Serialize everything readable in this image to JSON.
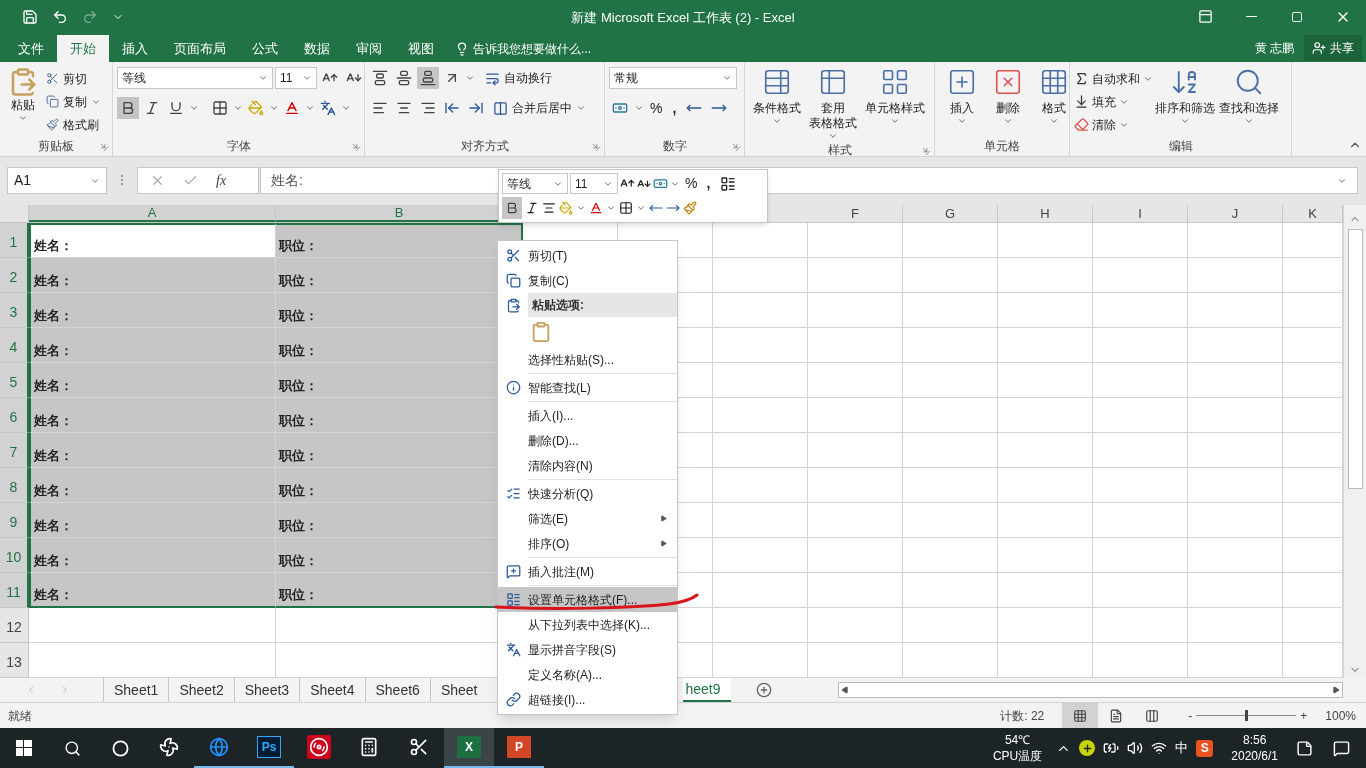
{
  "window": {
    "title": "新建 Microsoft Excel 工作表 (2) - Excel"
  },
  "tabs": [
    {
      "label": "文件",
      "selected": false
    },
    {
      "label": "开始",
      "selected": true
    },
    {
      "label": "插入",
      "selected": false
    },
    {
      "label": "页面布局",
      "selected": false
    },
    {
      "label": "公式",
      "selected": false
    },
    {
      "label": "数据",
      "selected": false
    },
    {
      "label": "审阅",
      "selected": false
    },
    {
      "label": "视图",
      "selected": false
    }
  ],
  "tell_me": {
    "placeholder": "告诉我您想要做什么..."
  },
  "user": {
    "name": "黄 志鹏",
    "share": "共享"
  },
  "ribbon": {
    "clipboard": {
      "label": "剪贴板",
      "paste": "粘贴",
      "items": [
        "剪切",
        "复制",
        "格式刷"
      ]
    },
    "font": {
      "label": "字体",
      "font_name": "等线",
      "font_size": "11",
      "toggles": [
        {
          "on": true
        },
        {
          "on": false
        },
        {
          "on": false
        }
      ]
    },
    "alignment": {
      "label": "对齐方式",
      "align_buttons": [
        {
          "on": false
        },
        {
          "on": false
        },
        {
          "on": true
        },
        {
          "on": false
        },
        {
          "on": false
        },
        {
          "on": false
        }
      ],
      "wrap": "自动换行",
      "merge": "合并后居中"
    },
    "number": {
      "label": "数字",
      "format": "常规",
      "percent": "%",
      "comma": ","
    },
    "styles": {
      "label": "样式",
      "buttons": [
        {
          "lines": [
            "条件格式"
          ]
        },
        {
          "lines": [
            "套用",
            "表格格式"
          ]
        },
        {
          "lines": [
            "单元格样式"
          ]
        }
      ]
    },
    "cells": {
      "label": "单元格",
      "buttons": [
        "插入",
        "删除",
        "格式"
      ]
    },
    "editing": {
      "label": "编辑",
      "small": [
        "自动求和",
        "填充",
        "清除"
      ],
      "large": [
        "排序和筛选",
        "查找和选择"
      ]
    }
  },
  "formula_bar": {
    "name_box": "A1",
    "fx": "fx",
    "value": "姓名:"
  },
  "columns": [
    {
      "label": "A",
      "selected": true
    },
    {
      "label": "B",
      "selected": true
    },
    {
      "label": "F",
      "selected": false
    },
    {
      "label": "G",
      "selected": false
    },
    {
      "label": "H",
      "selected": false
    },
    {
      "label": "I",
      "selected": false
    },
    {
      "label": "J",
      "selected": false
    },
    {
      "label": "K",
      "selected": false
    }
  ],
  "rows": [
    {
      "number": "1",
      "selected": true,
      "cells": [
        {
          "text": "姓名：",
          "selected": true,
          "active": true
        },
        {
          "text": "职位：",
          "selected": true,
          "active": false
        }
      ]
    },
    {
      "number": "2",
      "selected": true,
      "cells": [
        {
          "text": "姓名：",
          "selected": true,
          "active": false
        },
        {
          "text": "职位：",
          "selected": true,
          "active": false
        }
      ]
    },
    {
      "number": "3",
      "selected": true,
      "cells": [
        {
          "text": "姓名：",
          "selected": true,
          "active": false
        },
        {
          "text": "职位：",
          "selected": true,
          "active": false
        }
      ]
    },
    {
      "number": "4",
      "selected": true,
      "cells": [
        {
          "text": "姓名：",
          "selected": true,
          "active": false
        },
        {
          "text": "职位：",
          "selected": true,
          "active": false
        }
      ]
    },
    {
      "number": "5",
      "selected": true,
      "cells": [
        {
          "text": "姓名：",
          "selected": true,
          "active": false
        },
        {
          "text": "职位：",
          "selected": true,
          "active": false
        }
      ]
    },
    {
      "number": "6",
      "selected": true,
      "cells": [
        {
          "text": "姓名：",
          "selected": true,
          "active": false
        },
        {
          "text": "职位：",
          "selected": true,
          "active": false
        }
      ]
    },
    {
      "number": "7",
      "selected": true,
      "cells": [
        {
          "text": "姓名：",
          "selected": true,
          "active": false
        },
        {
          "text": "职位：",
          "selected": true,
          "active": false
        }
      ]
    },
    {
      "number": "8",
      "selected": true,
      "cells": [
        {
          "text": "姓名：",
          "selected": true,
          "active": false
        },
        {
          "text": "职位：",
          "selected": true,
          "active": false
        }
      ]
    },
    {
      "number": "9",
      "selected": true,
      "cells": [
        {
          "text": "姓名：",
          "selected": true,
          "active": false
        },
        {
          "text": "职位：",
          "selected": true,
          "active": false
        }
      ]
    },
    {
      "number": "10",
      "selected": true,
      "cells": [
        {
          "text": "姓名：",
          "selected": true,
          "active": false
        },
        {
          "text": "职位：",
          "selected": true,
          "active": false
        }
      ]
    },
    {
      "number": "11",
      "selected": true,
      "cells": [
        {
          "text": "姓名：",
          "selected": true,
          "active": false
        },
        {
          "text": "职位：",
          "selected": true,
          "active": false
        }
      ]
    },
    {
      "number": "12",
      "selected": false,
      "cells": []
    },
    {
      "number": "13",
      "selected": false,
      "cells": []
    }
  ],
  "mini_toolbar": {
    "font_name": "等线",
    "font_size": "11",
    "percent": "%",
    "comma": ",",
    "bold": {
      "on": true
    }
  },
  "context_menu": [
    {
      "kind": "item",
      "label": "剪切(T)",
      "selected": false
    },
    {
      "kind": "item",
      "label": "复制(C)",
      "selected": false
    },
    {
      "kind": "header",
      "label": "粘贴选项:"
    },
    {
      "kind": "paste",
      "selected": false
    },
    {
      "kind": "item",
      "label": "选择性粘贴(S)...",
      "selected": false
    },
    {
      "kind": "separator"
    },
    {
      "kind": "item",
      "label": "智能查找(L)",
      "selected": false
    },
    {
      "kind": "separator"
    },
    {
      "kind": "item",
      "label": "插入(I)...",
      "selected": false
    },
    {
      "kind": "item",
      "label": "删除(D)...",
      "selected": false
    },
    {
      "kind": "item",
      "label": "清除内容(N)",
      "selected": false
    },
    {
      "kind": "separator"
    },
    {
      "kind": "item",
      "label": "快速分析(Q)",
      "selected": false
    },
    {
      "kind": "submenu",
      "label": "筛选(E)",
      "selected": false
    },
    {
      "kind": "submenu",
      "label": "排序(O)",
      "selected": false
    },
    {
      "kind": "separator"
    },
    {
      "kind": "item",
      "label": "插入批注(M)",
      "selected": false
    },
    {
      "kind": "separator"
    },
    {
      "kind": "item",
      "label": "设置单元格格式(F)...",
      "selected": true
    },
    {
      "kind": "item",
      "label": "从下拉列表中选择(K)...",
      "selected": false
    },
    {
      "kind": "item",
      "label": "显示拼音字段(S)",
      "selected": false
    },
    {
      "kind": "item",
      "label": "定义名称(A)...",
      "selected": false
    },
    {
      "kind": "item",
      "label": "超链接(I)...",
      "selected": false
    }
  ],
  "sheet_tabs": [
    {
      "label": "Sheet1",
      "selected": false
    },
    {
      "label": "Sheet2",
      "selected": false
    },
    {
      "label": "Sheet3",
      "selected": false
    },
    {
      "label": "Sheet4",
      "selected": false
    },
    {
      "label": "Sheet6",
      "selected": false
    },
    {
      "label": "Sheet",
      "selected": false
    },
    {
      "label": "heet9",
      "selected": true
    }
  ],
  "status_bar": {
    "status": "就绪",
    "count": "计数: 22",
    "views": [
      {
        "selected": true
      },
      {
        "selected": false
      },
      {
        "selected": false
      }
    ],
    "zoom_out": "-",
    "zoom_in": "+",
    "zoom": {
      "level": 0.5
    },
    "zoom_text": "100%"
  },
  "taskbar": {
    "apps": [
      {
        "running": false,
        "active": false
      },
      {
        "running": true,
        "active": false
      },
      {
        "label": "Ps",
        "running": true,
        "active": false
      },
      {
        "running": false,
        "active": false
      },
      {
        "running": false,
        "active": false
      },
      {
        "running": false,
        "active": false
      },
      {
        "label": "X",
        "running": true,
        "active": true
      },
      {
        "label": "P",
        "running": true,
        "active": false
      }
    ],
    "temperature": "54℃",
    "temperature_label": "CPU温度",
    "ime": "中",
    "ime_app": "S",
    "time": "8:56",
    "date": "2020/6/1"
  }
}
